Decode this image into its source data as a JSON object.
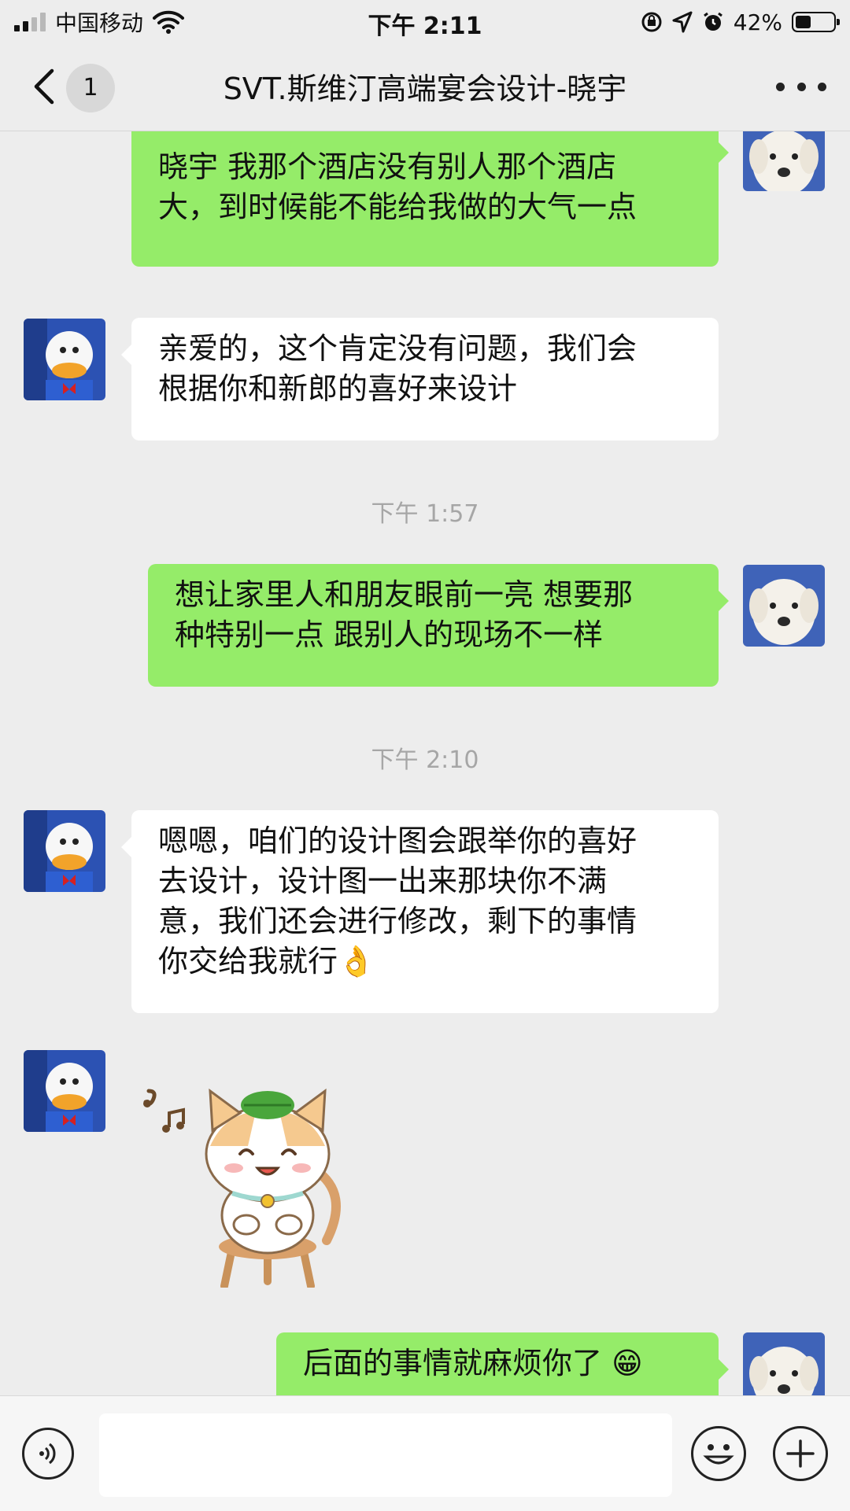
{
  "status_bar": {
    "carrier": "中国移动",
    "time": "下午 2:11",
    "battery_percent": "42%",
    "battery_level": 0.42,
    "signal_bars_filled": 2,
    "signal_bars_total": 4
  },
  "nav": {
    "unread_count": "1",
    "title": "SVT.斯维汀高端宴会设计-晓宇"
  },
  "messages": [
    {
      "direction": "out",
      "sender_avatar": "puppy-avatar",
      "text_lines": [
        "晓宇 我那个酒店没有别人那个酒店",
        "大，到时候能不能给我做的大气一点"
      ]
    },
    {
      "direction": "in",
      "sender_avatar": "duck-avatar",
      "text_lines": [
        "亲爱的，这个肯定没有问题，我们会",
        "根据你和新郎的喜好来设计"
      ]
    },
    {
      "type": "timestamp",
      "text": "下午 1:57"
    },
    {
      "direction": "out",
      "sender_avatar": "puppy-avatar",
      "text_lines": [
        "想让家里人和朋友眼前一亮  想要那",
        "种特别一点  跟别人的现场不一样"
      ]
    },
    {
      "type": "timestamp",
      "text": "下午 2:10"
    },
    {
      "direction": "in",
      "sender_avatar": "duck-avatar",
      "text_lines": [
        "嗯嗯，咱们的设计图会跟举你的喜好",
        "去设计，设计图一出来那块你不满",
        "意，我们还会进行修改，剩下的事情",
        "你交给我就行👌"
      ]
    },
    {
      "direction": "in",
      "sender_avatar": "duck-avatar",
      "type": "sticker",
      "sticker": "cat-on-stool-singing-sticker"
    },
    {
      "direction": "out",
      "sender_avatar": "puppy-avatar",
      "text_lines": [
        "后面的事情就麻烦你了  😁"
      ]
    }
  ],
  "input_bar": {
    "voice_icon": "voice-icon",
    "emoji_icon": "emoji-icon",
    "plus_icon": "plus-icon",
    "text_value": ""
  },
  "colors": {
    "background": "#ededed",
    "outgoing_bubble": "#95ec69",
    "incoming_bubble": "#ffffff",
    "timestamp_text": "#a6a6a6"
  }
}
